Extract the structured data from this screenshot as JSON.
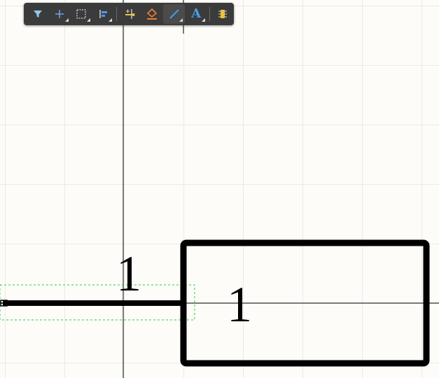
{
  "toolbar": {
    "buttons": [
      {
        "name": "filter-button",
        "icon": "filter-icon"
      },
      {
        "name": "add-cross-button",
        "icon": "crosshair-icon"
      },
      {
        "name": "select-rectangle-button",
        "icon": "rectangle-select-icon"
      },
      {
        "name": "align-button",
        "icon": "align-icon"
      },
      {
        "name": "place-pin-button",
        "icon": "pin-icon"
      },
      {
        "name": "fill-button",
        "icon": "fill-icon"
      },
      {
        "name": "place-line-button",
        "icon": "line-icon",
        "active": true
      },
      {
        "name": "place-text-button",
        "icon": "text-icon",
        "glyph": "A"
      },
      {
        "name": "component-button",
        "icon": "component-icon"
      }
    ]
  },
  "canvas": {
    "pin_designator": "1",
    "body_designator": "1",
    "colors": {
      "background": "#fdfcf9",
      "grid": "#cfcfcf",
      "stroke": "#000000",
      "selection": "#2fcf2f",
      "toolbar": "#3b3b3b",
      "accent_blue": "#4a9be8",
      "accent_orange": "#e8803a",
      "accent_yellow": "#e8c23a"
    }
  }
}
